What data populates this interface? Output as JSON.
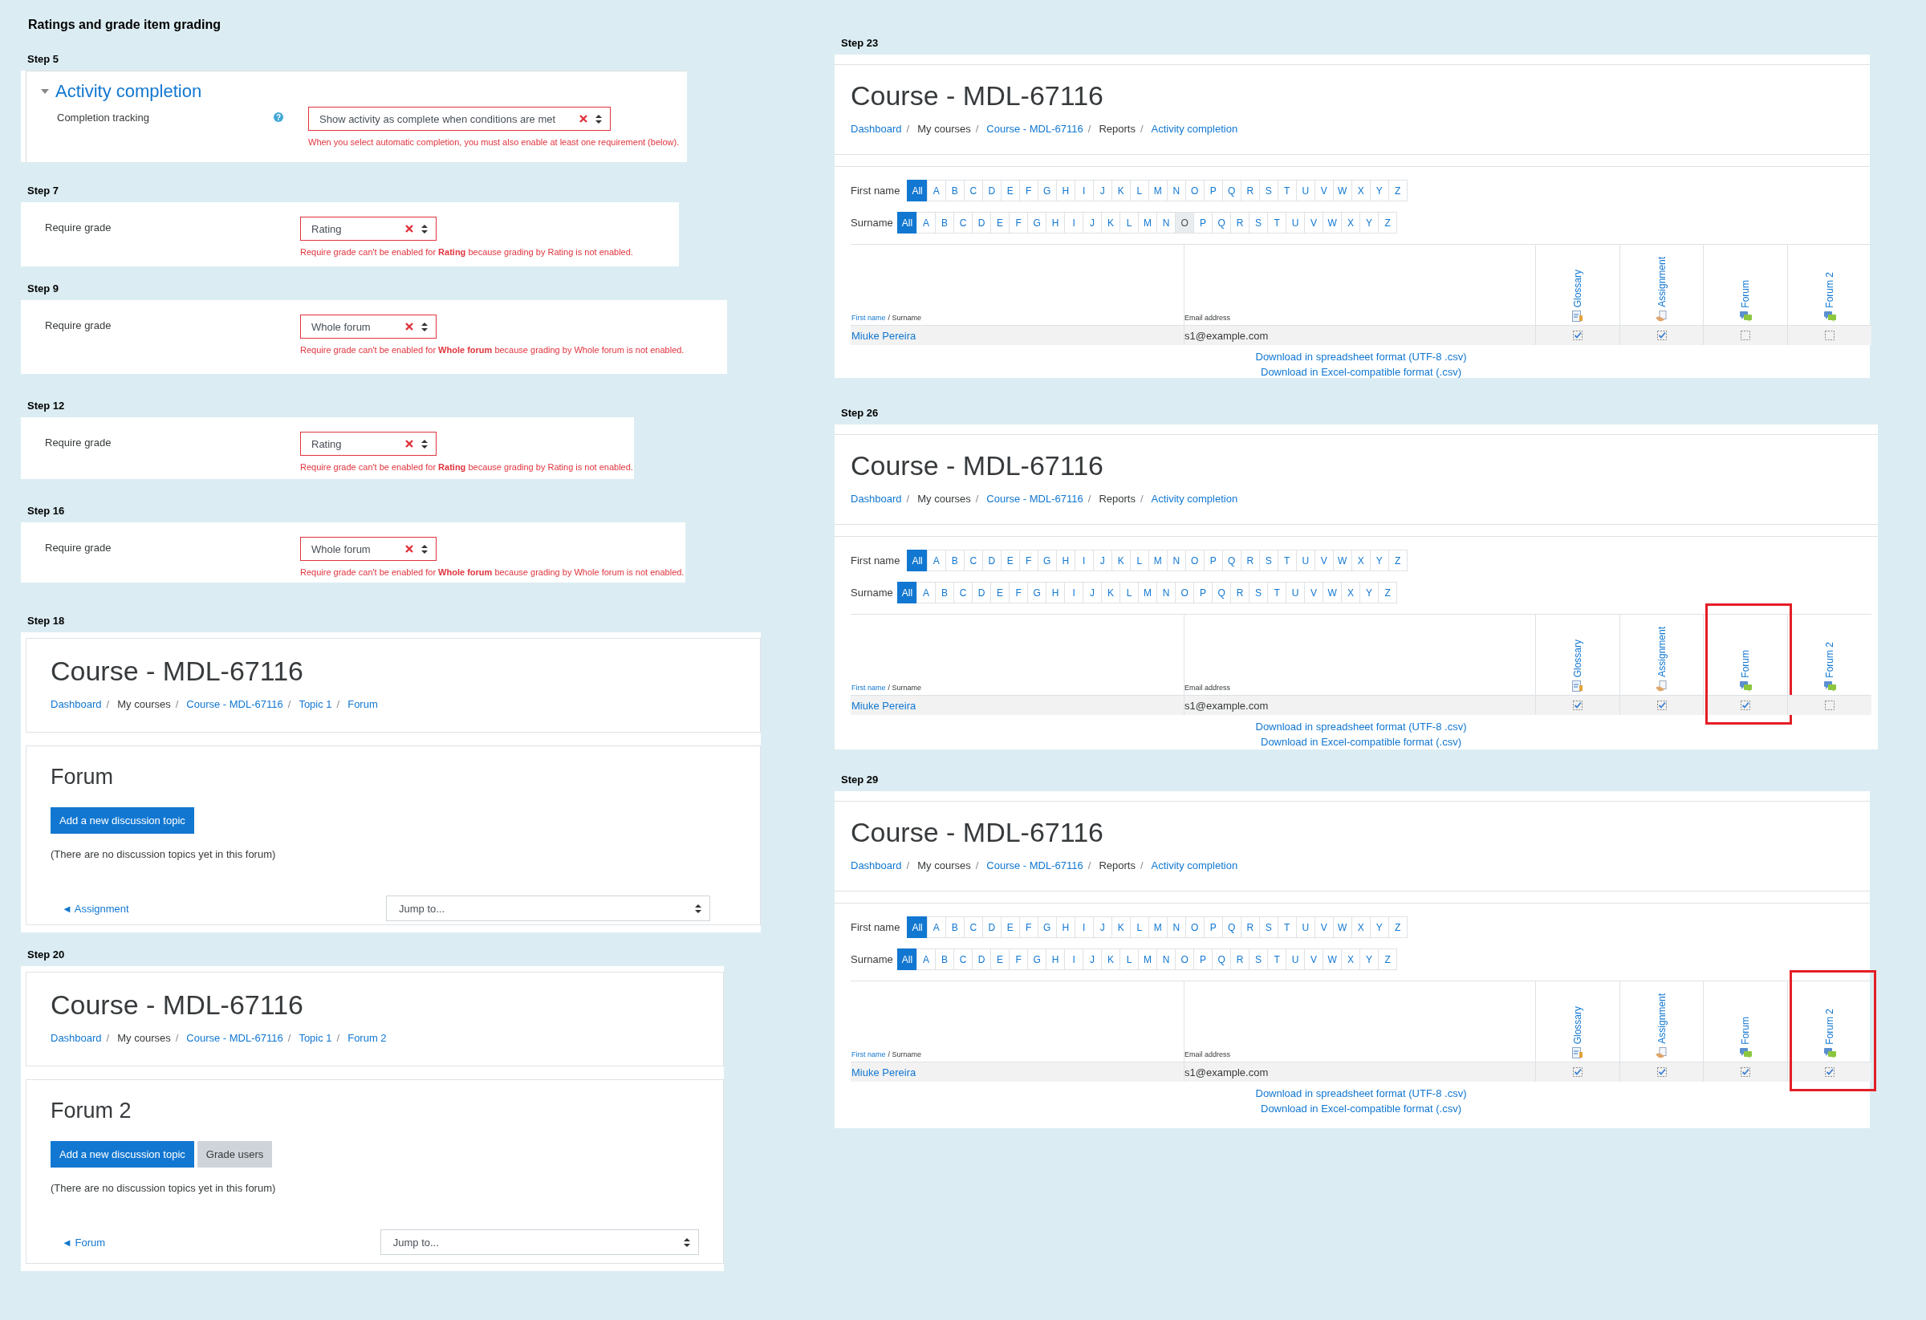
{
  "title": "Ratings and grade item grading",
  "left_steps": [
    {
      "label": "Step 5",
      "kind": "completion",
      "section_title": "Activity completion",
      "expanded": true,
      "field_label": "Completion tracking",
      "help_icon": "?",
      "select_value": "Show activity as complete when conditions are met",
      "error": "When you select automatic completion, you must also enable at least one requirement (below)."
    },
    {
      "label": "Step 7",
      "kind": "require_grade",
      "field_label": "Require grade",
      "select_value": "Rating",
      "error": "Require grade can't be enabled for **Rating** because grading by Rating is not enabled."
    },
    {
      "label": "Step 9",
      "kind": "require_grade",
      "field_label": "Require grade",
      "select_value": "Whole forum",
      "error": "Require grade can't be enabled for **Whole forum** because grading by Whole forum is not enabled."
    },
    {
      "label": "Step 12",
      "kind": "require_grade",
      "field_label": "Require grade",
      "select_value": "Rating",
      "error": "Require grade can't be enabled for **Rating** because grading by Rating is not enabled."
    },
    {
      "label": "Step 16",
      "kind": "require_grade",
      "field_label": "Require grade",
      "select_value": "Whole forum",
      "error": "Require grade can't be enabled for **Whole forum** because grading by Whole forum is not enabled."
    },
    {
      "label": "Step 18",
      "kind": "forum_page",
      "heading": "Course - MDL-67116",
      "breadcrumb_separator": "/",
      "breadcrumb": [
        {
          "text": "Dashboard",
          "link": true
        },
        {
          "text": "My courses",
          "link": false
        },
        {
          "text": "Course - MDL-67116",
          "link": true
        },
        {
          "text": "Topic 1",
          "link": true
        },
        {
          "text": "Forum",
          "link": true
        }
      ],
      "forum_title": "Forum",
      "buttons": [
        {
          "label": "Add a new discussion topic",
          "kind": "primary"
        }
      ],
      "empty_note": "(There are no discussion topics yet in this forum)",
      "prev_link": "◄ Assignment",
      "jump_placeholder": "Jump to..."
    },
    {
      "label": "Step 20",
      "kind": "forum_page",
      "heading": "Course - MDL-67116",
      "breadcrumb_separator": "/",
      "breadcrumb": [
        {
          "text": "Dashboard",
          "link": true
        },
        {
          "text": "My courses",
          "link": false
        },
        {
          "text": "Course - MDL-67116",
          "link": true
        },
        {
          "text": "Topic 1",
          "link": true
        },
        {
          "text": "Forum 2",
          "link": true
        }
      ],
      "forum_title": "Forum 2",
      "buttons": [
        {
          "label": "Add a new discussion topic",
          "kind": "primary"
        },
        {
          "label": "Grade users",
          "kind": "secondary"
        }
      ],
      "empty_note": "(There are no discussion topics yet in this forum)",
      "prev_link": "◄ Forum",
      "jump_placeholder": "Jump to..."
    }
  ],
  "right_steps": [
    {
      "label": "Step 23",
      "heading": "Course - MDL-67116",
      "breadcrumb_separator": "/",
      "breadcrumb": [
        {
          "text": "Dashboard",
          "link": true
        },
        {
          "text": "My courses",
          "link": false
        },
        {
          "text": "Course - MDL-67116",
          "link": true
        },
        {
          "text": "Reports",
          "link": false
        },
        {
          "text": "Activity completion",
          "link": true
        }
      ],
      "filters": [
        {
          "label": "First name",
          "letters": [
            {
              "text": "All",
              "selected": true,
              "hovered": false
            },
            {
              "text": "A",
              "selected": false,
              "hovered": false
            },
            {
              "text": "B",
              "selected": false,
              "hovered": false
            },
            {
              "text": "C",
              "selected": false,
              "hovered": false
            },
            {
              "text": "D",
              "selected": false,
              "hovered": false
            },
            {
              "text": "E",
              "selected": false,
              "hovered": false
            },
            {
              "text": "F",
              "selected": false,
              "hovered": false
            },
            {
              "text": "G",
              "selected": false,
              "hovered": false
            },
            {
              "text": "H",
              "selected": false,
              "hovered": false
            },
            {
              "text": "I",
              "selected": false,
              "hovered": false
            },
            {
              "text": "J",
              "selected": false,
              "hovered": false
            },
            {
              "text": "K",
              "selected": false,
              "hovered": false
            },
            {
              "text": "L",
              "selected": false,
              "hovered": false
            },
            {
              "text": "M",
              "selected": false,
              "hovered": false
            },
            {
              "text": "N",
              "selected": false,
              "hovered": false
            },
            {
              "text": "O",
              "selected": false,
              "hovered": false
            },
            {
              "text": "P",
              "selected": false,
              "hovered": false
            },
            {
              "text": "Q",
              "selected": false,
              "hovered": false
            },
            {
              "text": "R",
              "selected": false,
              "hovered": false
            },
            {
              "text": "S",
              "selected": false,
              "hovered": false
            },
            {
              "text": "T",
              "selected": false,
              "hovered": false
            },
            {
              "text": "U",
              "selected": false,
              "hovered": false
            },
            {
              "text": "V",
              "selected": false,
              "hovered": false
            },
            {
              "text": "W",
              "selected": false,
              "hovered": false
            },
            {
              "text": "X",
              "selected": false,
              "hovered": false
            },
            {
              "text": "Y",
              "selected": false,
              "hovered": false
            },
            {
              "text": "Z",
              "selected": false,
              "hovered": false
            }
          ]
        },
        {
          "label": "Surname",
          "letters": [
            {
              "text": "All",
              "selected": true,
              "hovered": false
            },
            {
              "text": "A",
              "selected": false,
              "hovered": false
            },
            {
              "text": "B",
              "selected": false,
              "hovered": false
            },
            {
              "text": "C",
              "selected": false,
              "hovered": false
            },
            {
              "text": "D",
              "selected": false,
              "hovered": false
            },
            {
              "text": "E",
              "selected": false,
              "hovered": false
            },
            {
              "text": "F",
              "selected": false,
              "hovered": false
            },
            {
              "text": "G",
              "selected": false,
              "hovered": false
            },
            {
              "text": "H",
              "selected": false,
              "hovered": false
            },
            {
              "text": "I",
              "selected": false,
              "hovered": false
            },
            {
              "text": "J",
              "selected": false,
              "hovered": false
            },
            {
              "text": "K",
              "selected": false,
              "hovered": false
            },
            {
              "text": "L",
              "selected": false,
              "hovered": false
            },
            {
              "text": "M",
              "selected": false,
              "hovered": false
            },
            {
              "text": "N",
              "selected": false,
              "hovered": false
            },
            {
              "text": "O",
              "selected": false,
              "hovered": true
            },
            {
              "text": "P",
              "selected": false,
              "hovered": false
            },
            {
              "text": "Q",
              "selected": false,
              "hovered": false
            },
            {
              "text": "R",
              "selected": false,
              "hovered": false
            },
            {
              "text": "S",
              "selected": false,
              "hovered": false
            },
            {
              "text": "T",
              "selected": false,
              "hovered": false
            },
            {
              "text": "U",
              "selected": false,
              "hovered": false
            },
            {
              "text": "V",
              "selected": false,
              "hovered": false
            },
            {
              "text": "W",
              "selected": false,
              "hovered": false
            },
            {
              "text": "X",
              "selected": false,
              "hovered": false
            },
            {
              "text": "Y",
              "selected": false,
              "hovered": false
            },
            {
              "text": "Z",
              "selected": false,
              "hovered": false
            }
          ]
        }
      ],
      "table": {
        "name_header": [
          {
            "text": "First name",
            "link": true
          },
          {
            "text": "/ Surname",
            "link": false
          }
        ],
        "email_header": "Email address",
        "activities": [
          {
            "name": "Glossary",
            "kind": "glossary",
            "highlighted": false
          },
          {
            "name": "Assignment",
            "kind": "assignment",
            "highlighted": false
          },
          {
            "name": "Forum",
            "kind": "forum",
            "highlighted": false
          },
          {
            "name": "Forum 2",
            "kind": "forum",
            "highlighted": false
          }
        ],
        "rows": [
          {
            "name": "Miuke Pereira",
            "email": "s1@example.com",
            "completions": [
              {
                "checked": true
              },
              {
                "checked": true
              },
              {
                "checked": false
              },
              {
                "checked": false
              }
            ]
          }
        ]
      },
      "downloads": [
        "Download in spreadsheet format (UTF-8 .csv)",
        "Download in Excel-compatible format (.csv)"
      ]
    },
    {
      "label": "Step 26",
      "heading": "Course - MDL-67116",
      "breadcrumb_separator": "/",
      "breadcrumb": [
        {
          "text": "Dashboard",
          "link": true
        },
        {
          "text": "My courses",
          "link": false
        },
        {
          "text": "Course - MDL-67116",
          "link": true
        },
        {
          "text": "Reports",
          "link": false
        },
        {
          "text": "Activity completion",
          "link": true
        }
      ],
      "filters": [
        {
          "label": "First name",
          "letters": [
            {
              "text": "All",
              "selected": true,
              "hovered": false
            },
            {
              "text": "A",
              "selected": false,
              "hovered": false
            },
            {
              "text": "B",
              "selected": false,
              "hovered": false
            },
            {
              "text": "C",
              "selected": false,
              "hovered": false
            },
            {
              "text": "D",
              "selected": false,
              "hovered": false
            },
            {
              "text": "E",
              "selected": false,
              "hovered": false
            },
            {
              "text": "F",
              "selected": false,
              "hovered": false
            },
            {
              "text": "G",
              "selected": false,
              "hovered": false
            },
            {
              "text": "H",
              "selected": false,
              "hovered": false
            },
            {
              "text": "I",
              "selected": false,
              "hovered": false
            },
            {
              "text": "J",
              "selected": false,
              "hovered": false
            },
            {
              "text": "K",
              "selected": false,
              "hovered": false
            },
            {
              "text": "L",
              "selected": false,
              "hovered": false
            },
            {
              "text": "M",
              "selected": false,
              "hovered": false
            },
            {
              "text": "N",
              "selected": false,
              "hovered": false
            },
            {
              "text": "O",
              "selected": false,
              "hovered": false
            },
            {
              "text": "P",
              "selected": false,
              "hovered": false
            },
            {
              "text": "Q",
              "selected": false,
              "hovered": false
            },
            {
              "text": "R",
              "selected": false,
              "hovered": false
            },
            {
              "text": "S",
              "selected": false,
              "hovered": false
            },
            {
              "text": "T",
              "selected": false,
              "hovered": false
            },
            {
              "text": "U",
              "selected": false,
              "hovered": false
            },
            {
              "text": "V",
              "selected": false,
              "hovered": false
            },
            {
              "text": "W",
              "selected": false,
              "hovered": false
            },
            {
              "text": "X",
              "selected": false,
              "hovered": false
            },
            {
              "text": "Y",
              "selected": false,
              "hovered": false
            },
            {
              "text": "Z",
              "selected": false,
              "hovered": false
            }
          ]
        },
        {
          "label": "Surname",
          "letters": [
            {
              "text": "All",
              "selected": true,
              "hovered": false
            },
            {
              "text": "A",
              "selected": false,
              "hovered": false
            },
            {
              "text": "B",
              "selected": false,
              "hovered": false
            },
            {
              "text": "C",
              "selected": false,
              "hovered": false
            },
            {
              "text": "D",
              "selected": false,
              "hovered": false
            },
            {
              "text": "E",
              "selected": false,
              "hovered": false
            },
            {
              "text": "F",
              "selected": false,
              "hovered": false
            },
            {
              "text": "G",
              "selected": false,
              "hovered": false
            },
            {
              "text": "H",
              "selected": false,
              "hovered": false
            },
            {
              "text": "I",
              "selected": false,
              "hovered": false
            },
            {
              "text": "J",
              "selected": false,
              "hovered": false
            },
            {
              "text": "K",
              "selected": false,
              "hovered": false
            },
            {
              "text": "L",
              "selected": false,
              "hovered": false
            },
            {
              "text": "M",
              "selected": false,
              "hovered": false
            },
            {
              "text": "N",
              "selected": false,
              "hovered": false
            },
            {
              "text": "O",
              "selected": false,
              "hovered": false
            },
            {
              "text": "P",
              "selected": false,
              "hovered": false
            },
            {
              "text": "Q",
              "selected": false,
              "hovered": false
            },
            {
              "text": "R",
              "selected": false,
              "hovered": false
            },
            {
              "text": "S",
              "selected": false,
              "hovered": false
            },
            {
              "text": "T",
              "selected": false,
              "hovered": false
            },
            {
              "text": "U",
              "selected": false,
              "hovered": false
            },
            {
              "text": "V",
              "selected": false,
              "hovered": false
            },
            {
              "text": "W",
              "selected": false,
              "hovered": false
            },
            {
              "text": "X",
              "selected": false,
              "hovered": false
            },
            {
              "text": "Y",
              "selected": false,
              "hovered": false
            },
            {
              "text": "Z",
              "selected": false,
              "hovered": false
            }
          ]
        }
      ],
      "table": {
        "name_header": [
          {
            "text": "First name",
            "link": true
          },
          {
            "text": "/ Surname",
            "link": false
          }
        ],
        "email_header": "Email address",
        "activities": [
          {
            "name": "Glossary",
            "kind": "glossary",
            "highlighted": false
          },
          {
            "name": "Assignment",
            "kind": "assignment",
            "highlighted": false
          },
          {
            "name": "Forum",
            "kind": "forum",
            "highlighted": true
          },
          {
            "name": "Forum 2",
            "kind": "forum",
            "highlighted": false
          }
        ],
        "rows": [
          {
            "name": "Miuke Pereira",
            "email": "s1@example.com",
            "completions": [
              {
                "checked": true
              },
              {
                "checked": true
              },
              {
                "checked": true
              },
              {
                "checked": false
              }
            ]
          }
        ]
      },
      "downloads": [
        "Download in spreadsheet format (UTF-8 .csv)",
        "Download in Excel-compatible format (.csv)"
      ]
    },
    {
      "label": "Step 29",
      "heading": "Course - MDL-67116",
      "breadcrumb_separator": "/",
      "breadcrumb": [
        {
          "text": "Dashboard",
          "link": true
        },
        {
          "text": "My courses",
          "link": false
        },
        {
          "text": "Course - MDL-67116",
          "link": true
        },
        {
          "text": "Reports",
          "link": false
        },
        {
          "text": "Activity completion",
          "link": true
        }
      ],
      "filters": [
        {
          "label": "First name",
          "letters": [
            {
              "text": "All",
              "selected": true,
              "hovered": false
            },
            {
              "text": "A",
              "selected": false,
              "hovered": false
            },
            {
              "text": "B",
              "selected": false,
              "hovered": false
            },
            {
              "text": "C",
              "selected": false,
              "hovered": false
            },
            {
              "text": "D",
              "selected": false,
              "hovered": false
            },
            {
              "text": "E",
              "selected": false,
              "hovered": false
            },
            {
              "text": "F",
              "selected": false,
              "hovered": false
            },
            {
              "text": "G",
              "selected": false,
              "hovered": false
            },
            {
              "text": "H",
              "selected": false,
              "hovered": false
            },
            {
              "text": "I",
              "selected": false,
              "hovered": false
            },
            {
              "text": "J",
              "selected": false,
              "hovered": false
            },
            {
              "text": "K",
              "selected": false,
              "hovered": false
            },
            {
              "text": "L",
              "selected": false,
              "hovered": false
            },
            {
              "text": "M",
              "selected": false,
              "hovered": false
            },
            {
              "text": "N",
              "selected": false,
              "hovered": false
            },
            {
              "text": "O",
              "selected": false,
              "hovered": false
            },
            {
              "text": "P",
              "selected": false,
              "hovered": false
            },
            {
              "text": "Q",
              "selected": false,
              "hovered": false
            },
            {
              "text": "R",
              "selected": false,
              "hovered": false
            },
            {
              "text": "S",
              "selected": false,
              "hovered": false
            },
            {
              "text": "T",
              "selected": false,
              "hovered": false
            },
            {
              "text": "U",
              "selected": false,
              "hovered": false
            },
            {
              "text": "V",
              "selected": false,
              "hovered": false
            },
            {
              "text": "W",
              "selected": false,
              "hovered": false
            },
            {
              "text": "X",
              "selected": false,
              "hovered": false
            },
            {
              "text": "Y",
              "selected": false,
              "hovered": false
            },
            {
              "text": "Z",
              "selected": false,
              "hovered": false
            }
          ]
        },
        {
          "label": "Surname",
          "letters": [
            {
              "text": "All",
              "selected": true,
              "hovered": false
            },
            {
              "text": "A",
              "selected": false,
              "hovered": false
            },
            {
              "text": "B",
              "selected": false,
              "hovered": false
            },
            {
              "text": "C",
              "selected": false,
              "hovered": false
            },
            {
              "text": "D",
              "selected": false,
              "hovered": false
            },
            {
              "text": "E",
              "selected": false,
              "hovered": false
            },
            {
              "text": "F",
              "selected": false,
              "hovered": false
            },
            {
              "text": "G",
              "selected": false,
              "hovered": false
            },
            {
              "text": "H",
              "selected": false,
              "hovered": false
            },
            {
              "text": "I",
              "selected": false,
              "hovered": false
            },
            {
              "text": "J",
              "selected": false,
              "hovered": false
            },
            {
              "text": "K",
              "selected": false,
              "hovered": false
            },
            {
              "text": "L",
              "selected": false,
              "hovered": false
            },
            {
              "text": "M",
              "selected": false,
              "hovered": false
            },
            {
              "text": "N",
              "selected": false,
              "hovered": false
            },
            {
              "text": "O",
              "selected": false,
              "hovered": false
            },
            {
              "text": "P",
              "selected": false,
              "hovered": false
            },
            {
              "text": "Q",
              "selected": false,
              "hovered": false
            },
            {
              "text": "R",
              "selected": false,
              "hovered": false
            },
            {
              "text": "S",
              "selected": false,
              "hovered": false
            },
            {
              "text": "T",
              "selected": false,
              "hovered": false
            },
            {
              "text": "U",
              "selected": false,
              "hovered": false
            },
            {
              "text": "V",
              "selected": false,
              "hovered": false
            },
            {
              "text": "W",
              "selected": false,
              "hovered": false
            },
            {
              "text": "X",
              "selected": false,
              "hovered": false
            },
            {
              "text": "Y",
              "selected": false,
              "hovered": false
            },
            {
              "text": "Z",
              "selected": false,
              "hovered": false
            }
          ]
        }
      ],
      "table": {
        "name_header": [
          {
            "text": "First name",
            "link": true
          },
          {
            "text": "/ Surname",
            "link": false
          }
        ],
        "email_header": "Email address",
        "activities": [
          {
            "name": "Glossary",
            "kind": "glossary",
            "highlighted": false
          },
          {
            "name": "Assignment",
            "kind": "assignment",
            "highlighted": false
          },
          {
            "name": "Forum",
            "kind": "forum",
            "highlighted": false
          },
          {
            "name": "Forum 2",
            "kind": "forum",
            "highlighted": true
          }
        ],
        "rows": [
          {
            "name": "Miuke Pereira",
            "email": "s1@example.com",
            "completions": [
              {
                "checked": true
              },
              {
                "checked": true
              },
              {
                "checked": true
              },
              {
                "checked": true
              }
            ]
          }
        ]
      },
      "downloads": [
        "Download in spreadsheet format (UTF-8 .csv)",
        "Download in Excel-compatible format (.csv)"
      ]
    }
  ]
}
